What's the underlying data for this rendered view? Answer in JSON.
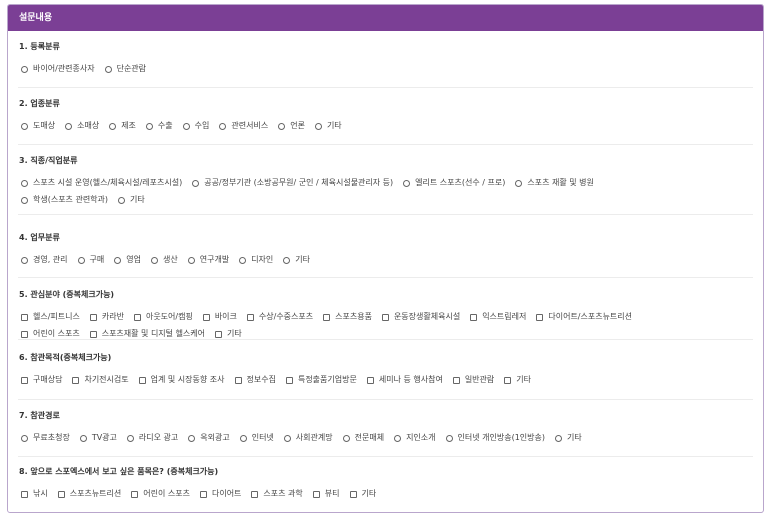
{
  "header": {
    "title": "설문내용"
  },
  "questions": [
    {
      "title": "1. 등록분류",
      "type": "radio",
      "rows": [
        [
          "바이어/관련종사자",
          "단순관람"
        ]
      ]
    },
    {
      "title": "2. 업종분류",
      "type": "radio",
      "rows": [
        [
          "도매상",
          "소매상",
          "제조",
          "수출",
          "수입",
          "관련서비스",
          "언론",
          "기타"
        ]
      ]
    },
    {
      "title": "3. 직종/직업분류",
      "type": "radio",
      "rows": [
        [
          "스포츠 시설 운영(헬스/체육시설/레포츠시설)",
          "공공/정부기관 (소방공무원/ 군인 / 체육시설물관리자 등)",
          "엘리트 스포츠(선수 / 프로)",
          "스포츠 재활 및 병원"
        ],
        [
          "학생(스포츠 관련학과)",
          "기타"
        ]
      ]
    },
    {
      "title": "4. 업무분류",
      "type": "radio",
      "rows": [
        [
          "경영, 관리",
          "구매",
          "영업",
          "생산",
          "연구개발",
          "디자인",
          "기타"
        ]
      ]
    },
    {
      "title": "5. 관심분야 (중복체크가능)",
      "type": "checkbox",
      "rows": [
        [
          "헬스/피트니스",
          "카라반",
          "아웃도어/캠핑",
          "바이크",
          "수상/수중스포츠",
          "스포츠용품",
          "운동장생활체육시설",
          "익스트림레저",
          "다이어트/스포츠뉴트리션"
        ],
        [
          "어린이 스포츠",
          "스포츠재활 및 디지털 헬스케어",
          "기타"
        ]
      ]
    },
    {
      "title": "6. 참관목적(중복체크가능)",
      "type": "checkbox",
      "rows": [
        [
          "구매상담",
          "차기전시검토",
          "업계 및 시장동향 조사",
          "정보수집",
          "특정출품기업방문",
          "세미나 등 행사참여",
          "일반관람",
          "기타"
        ]
      ]
    },
    {
      "title": "7. 참관경로",
      "type": "radio",
      "rows": [
        [
          "무료초청장",
          "TV광고",
          "라디오 광고",
          "옥외광고",
          "인터넷",
          "사회관계망",
          "전문매체",
          "지인소개",
          "인터넷 개인방송(1인방송)",
          "기타"
        ]
      ]
    },
    {
      "title": "8. 앞으로 스포엑스에서 보고 싶은 품목은? (중복체크가능)",
      "type": "checkbox",
      "rows": [
        [
          "낚시",
          "스포츠뉴트리션",
          "어린이 스포츠",
          "다이어트",
          "스포츠 과학",
          "뷰티",
          "기타"
        ]
      ]
    }
  ]
}
